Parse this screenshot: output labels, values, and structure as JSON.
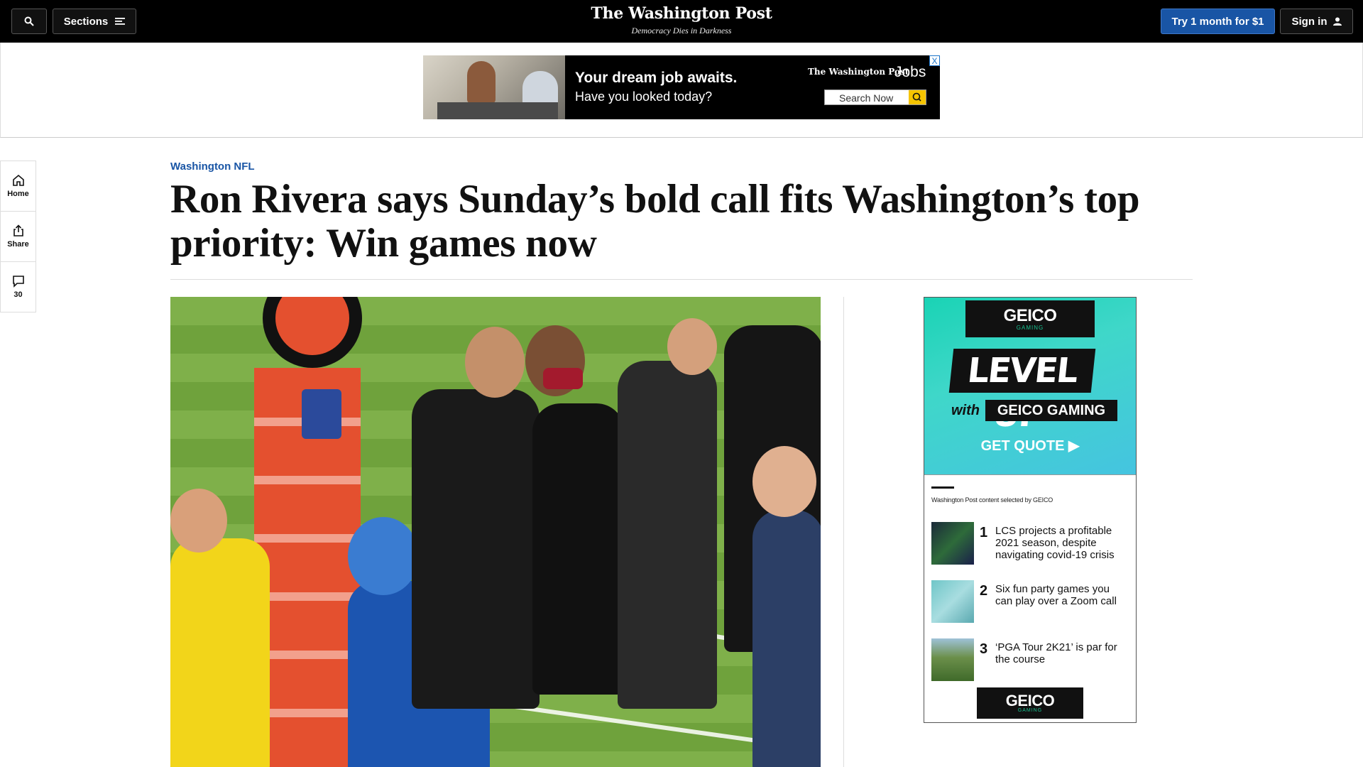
{
  "header": {
    "sections_label": "Sections",
    "logo": "The Washington Post",
    "tagline": "Democracy Dies in Darkness",
    "subscribe_label": "Try 1 month for $1",
    "signin_label": "Sign in",
    "subscribe_color": "#1955a5"
  },
  "banner_ad": {
    "headline": "Your dream job awaits.",
    "subline": "Have you looked today?",
    "brand": "The Washington Post",
    "jobs": "Jobs",
    "search_label": "Search Now",
    "close": "X"
  },
  "rail": {
    "home_label": "Home",
    "share_label": "Share",
    "comments_count": "30"
  },
  "article": {
    "kicker": "Washington NFL",
    "headline": "Ron Rivera says Sunday’s bold call fits Washington’s top priority: Win games now",
    "kicker_color": "#1955a5"
  },
  "sidebar_ad": {
    "brand": "GEICO",
    "brand_sub": "GAMING",
    "level_up": "LEVEL UP",
    "with": "with",
    "gaming": "GEICO GAMING",
    "cta": "GET QUOTE ▶",
    "selected_by": "Washington Post content selected by GEICO",
    "items": [
      {
        "num": "1",
        "text": "LCS projects a profitable 2021 season, despite navigating covid-19 crisis"
      },
      {
        "num": "2",
        "text": "Six fun party games you can play over a Zoom call"
      },
      {
        "num": "3",
        "text": "‘PGA Tour 2K21’ is par for the course"
      }
    ],
    "footer_brand": "GEICO",
    "footer_sub": "GAMING"
  }
}
